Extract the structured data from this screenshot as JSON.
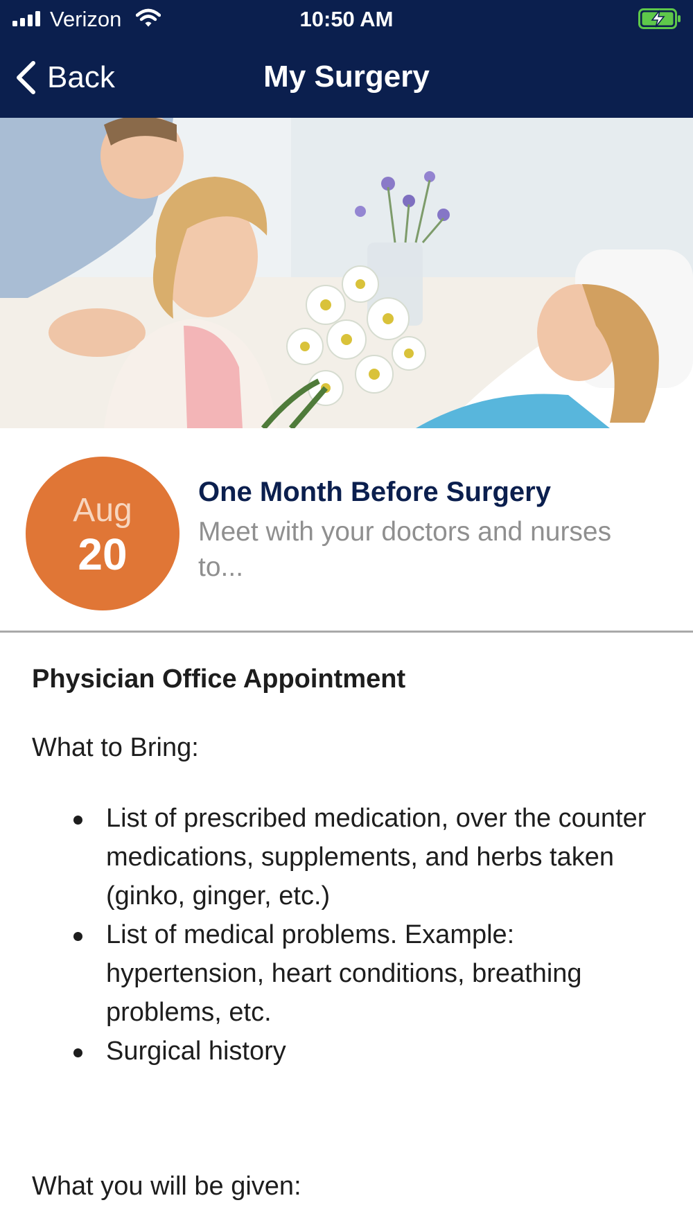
{
  "status_bar": {
    "carrier": "Verizon",
    "time": "10:50 AM",
    "battery_color": "#5ec84a"
  },
  "nav": {
    "back_label": "Back",
    "title": "My Surgery"
  },
  "hero": {
    "icon": "hero-photo"
  },
  "event": {
    "month": "Aug",
    "day": "20",
    "title": "One Month Before Surgery",
    "summary": "Meet with your doctors and nurses to...",
    "accent_color": "#e07636"
  },
  "detail": {
    "section_title": "Physician Office Appointment",
    "bring_label": "What to Bring:",
    "bring_items": [
      "List of prescribed medication, over the counter medications, supplements, and herbs taken (ginko, ginger, etc.)",
      "List of medical problems. Example: hypertension, heart conditions, breathing problems, etc.",
      "Surgical history"
    ],
    "given_label": "What you will be given:"
  },
  "colors": {
    "nav_background": "#0b1f4e",
    "title_text": "#0b1f4e",
    "muted_text": "#8f8f8f"
  }
}
